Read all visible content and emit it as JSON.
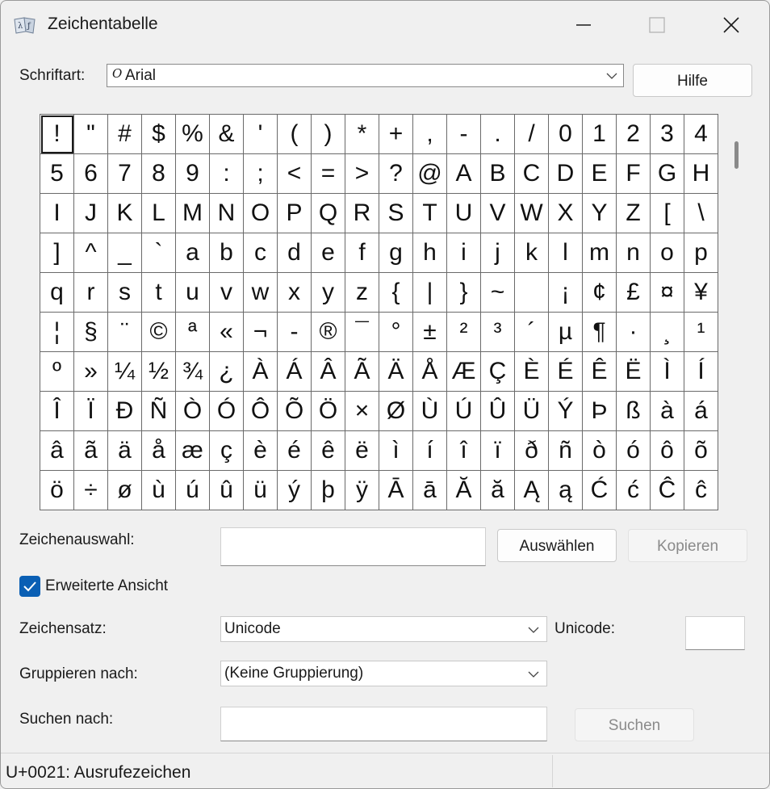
{
  "window": {
    "title": "Zeichentabelle"
  },
  "font": {
    "label": "Schriftart:",
    "value": "Arial",
    "help_button": "Hilfe"
  },
  "characters": [
    "!",
    "\"",
    "#",
    "$",
    "%",
    "&",
    "'",
    "(",
    ")",
    "*",
    "+",
    ",",
    "-",
    ".",
    "/",
    "0",
    "1",
    "2",
    "3",
    "4",
    "5",
    "6",
    "7",
    "8",
    "9",
    ":",
    ";",
    "<",
    "=",
    ">",
    "?",
    "@",
    "A",
    "B",
    "C",
    "D",
    "E",
    "F",
    "G",
    "H",
    "I",
    "J",
    "K",
    "L",
    "M",
    "N",
    "O",
    "P",
    "Q",
    "R",
    "S",
    "T",
    "U",
    "V",
    "W",
    "X",
    "Y",
    "Z",
    "[",
    "\\",
    "]",
    "^",
    "_",
    "`",
    "a",
    "b",
    "c",
    "d",
    "e",
    "f",
    "g",
    "h",
    "i",
    "j",
    "k",
    "l",
    "m",
    "n",
    "o",
    "p",
    "q",
    "r",
    "s",
    "t",
    "u",
    "v",
    "w",
    "x",
    "y",
    "z",
    "{",
    "|",
    "}",
    "~",
    " ",
    "¡",
    "¢",
    "£",
    "¤",
    "¥",
    "¦",
    "§",
    "¨",
    "©",
    "ª",
    "«",
    "¬",
    "-",
    "®",
    "¯",
    "°",
    "±",
    "²",
    "³",
    "´",
    "µ",
    "¶",
    "·",
    "¸",
    "¹",
    "º",
    "»",
    "¼",
    "½",
    "¾",
    "¿",
    "À",
    "Á",
    "Â",
    "Ã",
    "Ä",
    "Å",
    "Æ",
    "Ç",
    "È",
    "É",
    "Ê",
    "Ë",
    "Ì",
    "Í",
    "Î",
    "Ï",
    "Ð",
    "Ñ",
    "Ò",
    "Ó",
    "Ô",
    "Õ",
    "Ö",
    "×",
    "Ø",
    "Ù",
    "Ú",
    "Û",
    "Ü",
    "Ý",
    "Þ",
    "ß",
    "à",
    "á",
    "â",
    "ã",
    "ä",
    "å",
    "æ",
    "ç",
    "è",
    "é",
    "ê",
    "ë",
    "ì",
    "í",
    "î",
    "ï",
    "ð",
    "ñ",
    "ò",
    "ó",
    "ô",
    "õ",
    "ö",
    "÷",
    "ø",
    "ù",
    "ú",
    "û",
    "ü",
    "ý",
    "þ",
    "ÿ",
    "Ā",
    "ā",
    "Ă",
    "ă",
    "Ą",
    "ą",
    "Ć",
    "ć",
    "Ĉ",
    "ĉ"
  ],
  "selection": {
    "label": "Zeichenauswahl:",
    "value": "",
    "select_button": "Auswählen",
    "copy_button": "Kopieren"
  },
  "advanced_view": {
    "label": "Erweiterte Ansicht",
    "checked": true
  },
  "charset": {
    "label": "Zeichensatz:",
    "value": "Unicode",
    "unicode_label": "Unicode:",
    "unicode_value": ""
  },
  "grouping": {
    "label": "Gruppieren nach:",
    "value": "(Keine Gruppierung)"
  },
  "search": {
    "label": "Suchen nach:",
    "value": "",
    "button": "Suchen"
  },
  "status": {
    "text": "U+0021: Ausrufezeichen"
  },
  "colors": {
    "accent": "#0a5fb4",
    "background": "#f0f0f0"
  }
}
